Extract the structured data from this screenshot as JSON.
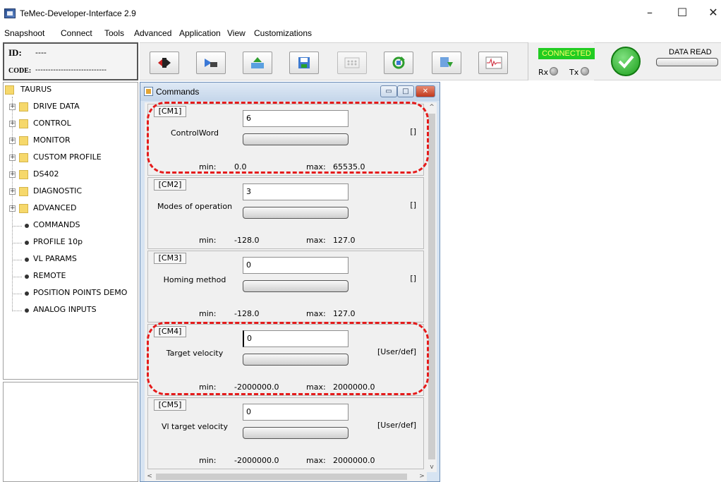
{
  "window": {
    "title": "TeMec-Developer-Interface 2.9",
    "minimize_glyph": "–",
    "maximize_glyph": "☐",
    "close_glyph": "✕"
  },
  "menu": [
    "Snapshoot",
    "Connect",
    "Tools",
    "Advanced",
    "Application",
    "View",
    "Customizations"
  ],
  "id_panel": {
    "id_label": "ID:",
    "id_value": "----",
    "code_label": "CODE:",
    "code_value": "----------------------------"
  },
  "toolbar": {
    "buttons": [
      "reset-icon",
      "connect-icon",
      "upload-icon",
      "save-icon",
      "grid-icon",
      "refresh-icon",
      "download-icon",
      "oscilloscope-icon"
    ]
  },
  "status": {
    "connected": "CONNECTED",
    "rx": "Rx",
    "tx": "Tx",
    "data_read": "DATA READ",
    "connected_color": "#22cc22",
    "connected_text_color": "#ffff66"
  },
  "tree": {
    "root": "TAURUS",
    "folders": [
      "DRIVE DATA",
      "CONTROL",
      "MONITOR",
      "CUSTOM PROFILE",
      "DS402",
      "DIAGNOSTIC",
      "ADVANCED"
    ],
    "leaves": [
      "COMMANDS",
      "PROFILE 10p",
      "VL PARAMS",
      "REMOTE",
      "POSITION POINTS DEMO",
      "ANALOG INPUTS"
    ]
  },
  "commands_window": {
    "title": "Commands",
    "min_glyph": "▭",
    "max_glyph": "□",
    "close_glyph": "✕"
  },
  "commands": [
    {
      "tag": "[CM1]",
      "name": "ControlWord",
      "value": "6",
      "unit": "[]",
      "min_label": "min:",
      "min": "0.0",
      "max_label": "max:",
      "max": "65535.0"
    },
    {
      "tag": "[CM2]",
      "name": "Modes of operation",
      "value": "3",
      "unit": "[]",
      "min_label": "min:",
      "min": "-128.0",
      "max_label": "max:",
      "max": "127.0"
    },
    {
      "tag": "[CM3]",
      "name": "Homing method",
      "value": "0",
      "unit": "[]",
      "min_label": "min:",
      "min": "-128.0",
      "max_label": "max:",
      "max": "127.0"
    },
    {
      "tag": "[CM4]",
      "name": "Target velocity",
      "value": "0",
      "unit": "[User/def]",
      "min_label": "min:",
      "min": "-2000000.0",
      "max_label": "max:",
      "max": "2000000.0"
    },
    {
      "tag": "[CM5]",
      "name": "Vl target velocity",
      "value": "0",
      "unit": "[User/def]",
      "min_label": "min:",
      "min": "-2000000.0",
      "max_label": "max:",
      "max": "2000000.0"
    }
  ],
  "scroll": {
    "up": "^",
    "down": "v",
    "left": "<",
    "right": ">"
  },
  "annotations": {
    "highlight_color": "#e51b1b"
  }
}
